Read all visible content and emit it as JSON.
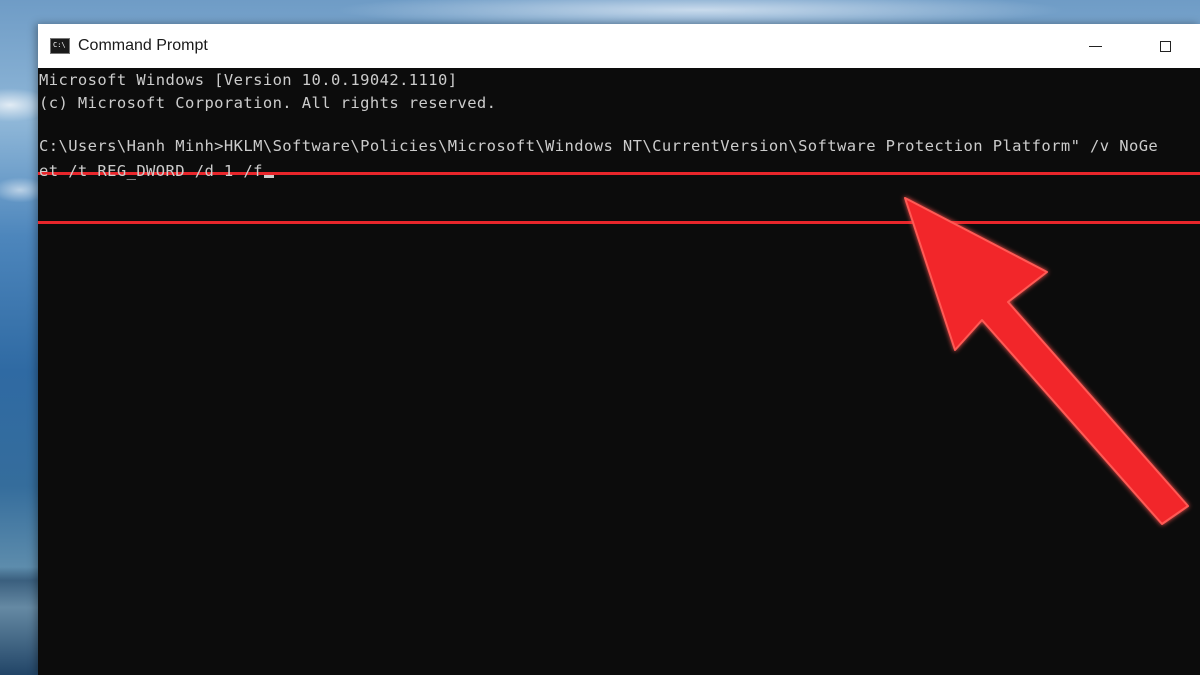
{
  "window": {
    "title": "Command Prompt"
  },
  "console": {
    "lines": [
      "Microsoft Windows [Version 10.0.19042.1110]",
      "(c) Microsoft Corporation. All rights reserved.",
      "C:\\Users\\Hanh Minh>HKLM\\Software\\Policies\\Microsoft\\Windows NT\\CurrentVersion\\Software Protection Platform\" /v NoGe",
      "et /t REG_DWORD /d 1 /f"
    ]
  },
  "icons": {
    "app": "command-prompt-icon",
    "minimize": "minimize-icon",
    "maximize": "maximize-icon",
    "annotation": "red-arrow-icon"
  },
  "colors": {
    "console_bg": "#0c0c0c",
    "console_text": "#cccccc",
    "highlight": "#e8262b",
    "arrow": "#f2282c"
  }
}
